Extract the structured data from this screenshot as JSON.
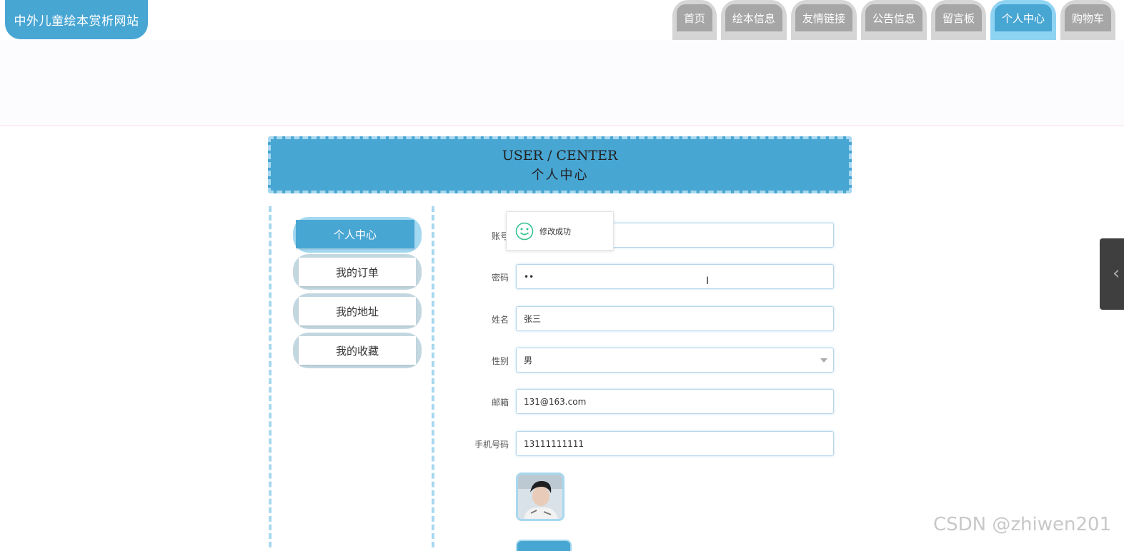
{
  "brand": "中外儿童绘本赏析网站",
  "nav": [
    {
      "label": "首页",
      "active": false
    },
    {
      "label": "绘本信息",
      "active": false
    },
    {
      "label": "友情链接",
      "active": false
    },
    {
      "label": "公告信息",
      "active": false
    },
    {
      "label": "留言板",
      "active": false
    },
    {
      "label": "个人中心",
      "active": true
    },
    {
      "label": "购物车",
      "active": false
    }
  ],
  "header": {
    "en": "USER / CENTER",
    "cn": "个人中心"
  },
  "menu": [
    {
      "label": "个人中心",
      "active": true
    },
    {
      "label": "我的订单",
      "active": false
    },
    {
      "label": "我的地址",
      "active": false
    },
    {
      "label": "我的收藏",
      "active": false
    }
  ],
  "form": {
    "account": {
      "label": "账号",
      "value": ""
    },
    "password": {
      "label": "密码",
      "value": "••"
    },
    "name": {
      "label": "姓名",
      "value": "张三"
    },
    "gender": {
      "label": "性别",
      "value": "男"
    },
    "email": {
      "label": "邮箱",
      "value": "131@163.com"
    },
    "phone": {
      "label": "手机号码",
      "value": "13111111111"
    }
  },
  "toast": {
    "message": "修改成功",
    "icon": "smile-icon"
  },
  "side_tab": {
    "icon": "chevron-left-icon"
  },
  "watermark": "CSDN @zhiwen201",
  "colors": {
    "accent": "#48a6d3",
    "accent_light": "#a8d8ef",
    "nav_inactive": "#a6a6a6"
  }
}
